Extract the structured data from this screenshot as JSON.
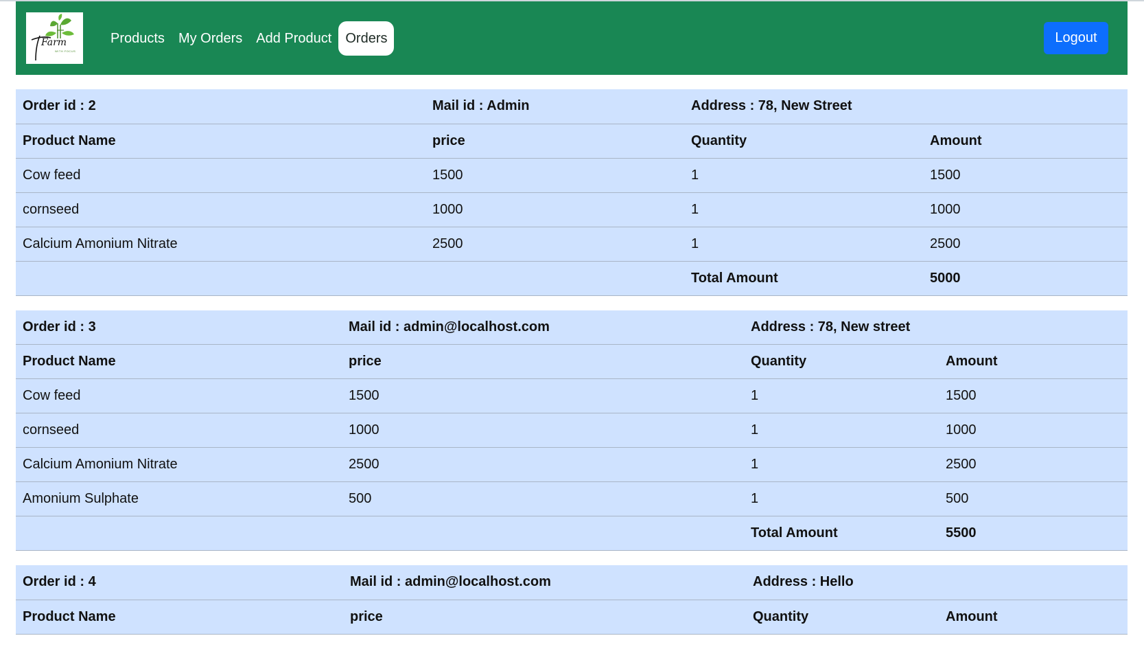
{
  "navbar": {
    "logo_text": "Farm",
    "logo_subtext": "WITH FOCUS",
    "links": [
      {
        "label": "Products"
      },
      {
        "label": "My Orders"
      },
      {
        "label": "Add Product"
      },
      {
        "label": "Orders"
      }
    ],
    "active_link": "Orders",
    "logout_label": "Logout"
  },
  "colors": {
    "navbar_bg": "#198754",
    "table_bg": "#cfe2ff",
    "logout_bg": "#0d6efd"
  },
  "orders": [
    {
      "order_id": "Order id : 2",
      "mail": "Mail id : Admin",
      "address": "Address : 78, New Street",
      "headers": [
        "Product Name",
        "price",
        "Quantity",
        "Amount"
      ],
      "rows": [
        [
          "Cow feed",
          "1500",
          "1",
          "1500"
        ],
        [
          "cornseed",
          "1000",
          "1",
          "1000"
        ],
        [
          "Calcium Amonium Nitrate",
          "2500",
          "1",
          "2500"
        ]
      ],
      "total_label": "Total Amount",
      "total_value": "5000"
    },
    {
      "order_id": "Order id : 3",
      "mail": "Mail id : admin@localhost.com",
      "address": "Address : 78, New street",
      "headers": [
        "Product Name",
        "price",
        "Quantity",
        "Amount"
      ],
      "rows": [
        [
          "Cow feed",
          "1500",
          "1",
          "1500"
        ],
        [
          "cornseed",
          "1000",
          "1",
          "1000"
        ],
        [
          "Calcium Amonium Nitrate",
          "2500",
          "1",
          "2500"
        ],
        [
          "Amonium Sulphate",
          "500",
          "1",
          "500"
        ]
      ],
      "total_label": "Total Amount",
      "total_value": "5500"
    },
    {
      "order_id": "Order id : 4",
      "mail": "Mail id : admin@localhost.com",
      "address": "Address : Hello",
      "headers": [
        "Product Name",
        "price",
        "Quantity",
        "Amount"
      ],
      "rows": [],
      "total_label": "",
      "total_value": ""
    }
  ]
}
